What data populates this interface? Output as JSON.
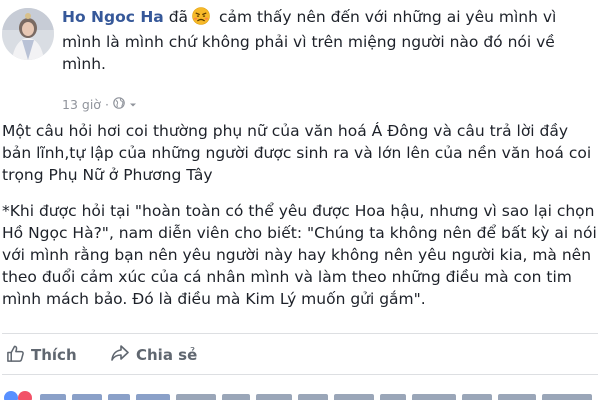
{
  "post": {
    "author": "Ho Ngoc Ha",
    "feeling_prefix": "đã",
    "feeling_text": "cảm thấy nên đến với những ai yêu mình vì mình là mình chứ không phải vì trên miệng người nào đó nói về mình.",
    "feeling_icon": "frustrated-face-emoji",
    "timestamp": "13 giờ",
    "privacy_icon": "globe-icon",
    "paragraphs": [
      "Một câu hỏi hơi coi thường phụ nữ của văn hoá Á Đông và câu trả lời đầy bản lĩnh,tự lập của những người được sinh ra và lớn lên của nền văn hoá coi trọng Phụ Nữ ở Phương Tây",
      "*Khi được hỏi tại \"hoàn toàn có thể yêu được Hoa hậu, nhưng vì sao lại chọn Hồ Ngọc Hà?\", nam diễn viên cho biết: \"Chúng ta không nên để bất kỳ ai nói với mình rằng bạn nên yêu người này hay không nên yêu người kia, mà nên theo đuổi cảm xúc của cá nhân mình và làm theo những điều mà con tim mình mách bảo. Đó là điều mà Kim Lý muốn gửi gắm\"."
    ]
  },
  "actions": {
    "like_label": "Thích",
    "share_label": "Chia sẻ",
    "like_icon": "thumbs-up-icon",
    "share_icon": "share-arrow-icon"
  },
  "colors": {
    "author_link": "#365899",
    "text": "#1d2129",
    "meta": "#90949c",
    "action": "#606770",
    "divider": "#dddfe2"
  }
}
